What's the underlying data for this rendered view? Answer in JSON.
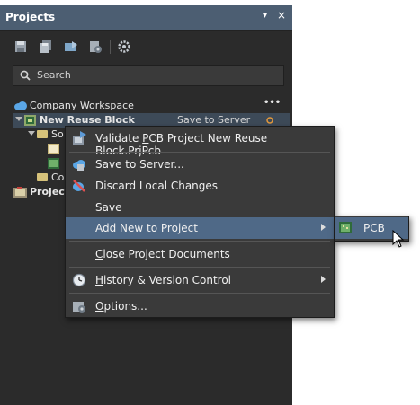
{
  "panel": {
    "title": "Projects",
    "pin_glyph": "▾",
    "close_glyph": "×"
  },
  "toolbar": {
    "icons": [
      "save-icon",
      "save-all-icon",
      "open-icon",
      "compile-icon",
      "settings-icon"
    ]
  },
  "search": {
    "label": "Search"
  },
  "tree": {
    "workspace": "Company Workspace",
    "more": "•••",
    "project": "New Reuse Block",
    "project_status": "Save to Server",
    "child1": "So",
    "child3": "Co",
    "project2": "Project"
  },
  "menu": {
    "items": [
      {
        "pre": "Validate ",
        "ul": "P",
        "post": "CB Project New Reuse Block.PrjPcb"
      },
      {
        "pre": "Save to Server...",
        "ul": "",
        "post": ""
      },
      {
        "pre": "Discard Local Changes",
        "ul": "",
        "post": ""
      },
      {
        "pre": "Save",
        "ul": "",
        "post": ""
      },
      {
        "pre": "Add ",
        "ul": "N",
        "post": "ew to Project"
      },
      {
        "pre": "",
        "ul": "C",
        "post": "lose Project Documents"
      },
      {
        "pre": "",
        "ul": "H",
        "post": "istory & Version Control"
      },
      {
        "pre": "",
        "ul": "O",
        "post": "ptions..."
      }
    ]
  },
  "submenu": {
    "item": {
      "pre": "",
      "ul": "P",
      "post": "CB"
    }
  },
  "colors": {
    "panel_bg": "#2b2b2b",
    "title_bar": "#4c5e72",
    "highlight": "#4f6987",
    "menu_bg": "#3a3a3a"
  }
}
